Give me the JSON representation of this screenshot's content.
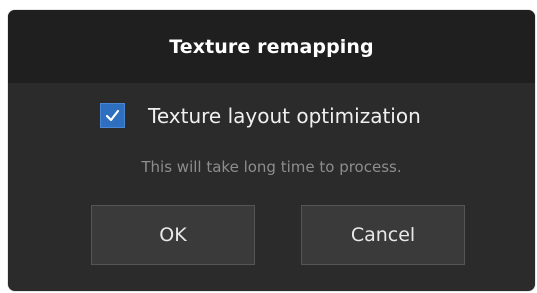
{
  "dialog": {
    "title": "Texture remapping",
    "option": {
      "label": "Texture layout optimization",
      "checked": true
    },
    "hint": "This will take long time to process.",
    "buttons": {
      "ok_label": "OK",
      "cancel_label": "Cancel"
    }
  },
  "colors": {
    "dialog_background": "#2b2b2b",
    "title_bar_background": "#1f1f1f",
    "checkbox_accent": "#2f6fc0",
    "button_background": "#3a3a3a",
    "hint_text": "#8d8d8d"
  },
  "icons": {
    "checkbox_mark": "checkmark-icon"
  }
}
